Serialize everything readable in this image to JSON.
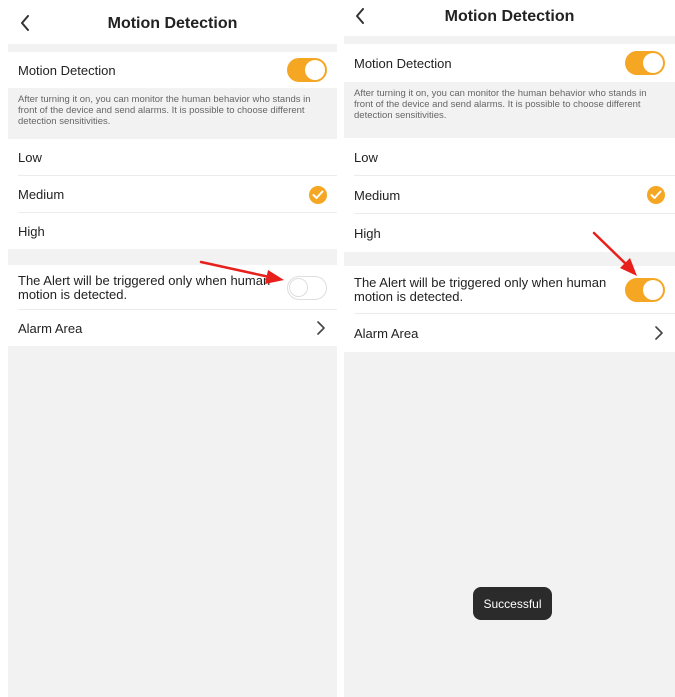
{
  "left": {
    "header": {
      "title": "Motion Detection"
    },
    "motion_detection": {
      "label": "Motion Detection",
      "toggle_on": true
    },
    "description": "After turning it on, you can monitor the human behavior who stands in front of the device and send alarms. It is possible to choose different detection sensitivities.",
    "sensitivity": {
      "options": [
        "Low",
        "Medium",
        "High"
      ],
      "selected": "Medium"
    },
    "human_alert": {
      "label": "The Alert will be triggered only when human motion is detected.",
      "toggle_on": false
    },
    "alarm_area": {
      "label": "Alarm Area"
    }
  },
  "right": {
    "header": {
      "title": "Motion Detection"
    },
    "motion_detection": {
      "label": "Motion Detection",
      "toggle_on": true
    },
    "description": "After turning it on, you can monitor the human behavior who stands in front of the device and send alarms. It is possible to choose different detection sensitivities.",
    "sensitivity": {
      "options": [
        "Low",
        "Medium",
        "High"
      ],
      "selected": "Medium"
    },
    "human_alert": {
      "label": "The Alert will be triggered only when human motion is detected.",
      "toggle_on": true
    },
    "alarm_area": {
      "label": "Alarm Area"
    },
    "toast": "Successful"
  },
  "colors": {
    "accent": "#f5a623",
    "annotation_arrow": "#e8201c",
    "background": "#f2f2f2"
  },
  "icons": [
    "back-chevron-icon",
    "check-circle-icon",
    "chevron-right-icon",
    "annotation-arrow-icon"
  ]
}
